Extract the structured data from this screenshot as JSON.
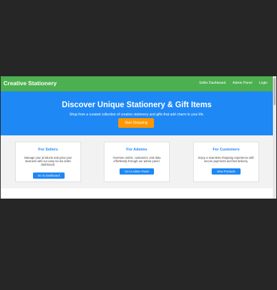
{
  "navbar": {
    "brand": "Creative Stationery",
    "links": [
      "Seller Dashboard",
      "Admin Panel",
      "Login"
    ]
  },
  "hero": {
    "title": "Discover Unique Stationery & Gift Items",
    "subtitle": "Shop from a curated collection of creative stationery and gifts that add charm to your life.",
    "button_label": "Start Shopping"
  },
  "cards": [
    {
      "title": "For Sellers",
      "description": "Manage your products and grow your business with our easy-to-use seller dashboard.",
      "button_label": "Go to Dashboard"
    },
    {
      "title": "For Admins",
      "description": "Oversee orders, customers, and data effortlessly through our admin panel.",
      "button_label": "Go to Admin Panel"
    },
    {
      "title": "For Customers",
      "description": "Enjoy a seamless shopping experience with secure payments and fast delivery.",
      "button_label": "View Products"
    }
  ],
  "colors": {
    "navbar": "#4caf50",
    "hero": "#1e88f5",
    "cta": "#ff9800",
    "card_accent": "#1e88f5",
    "outer_background": "#262626"
  }
}
